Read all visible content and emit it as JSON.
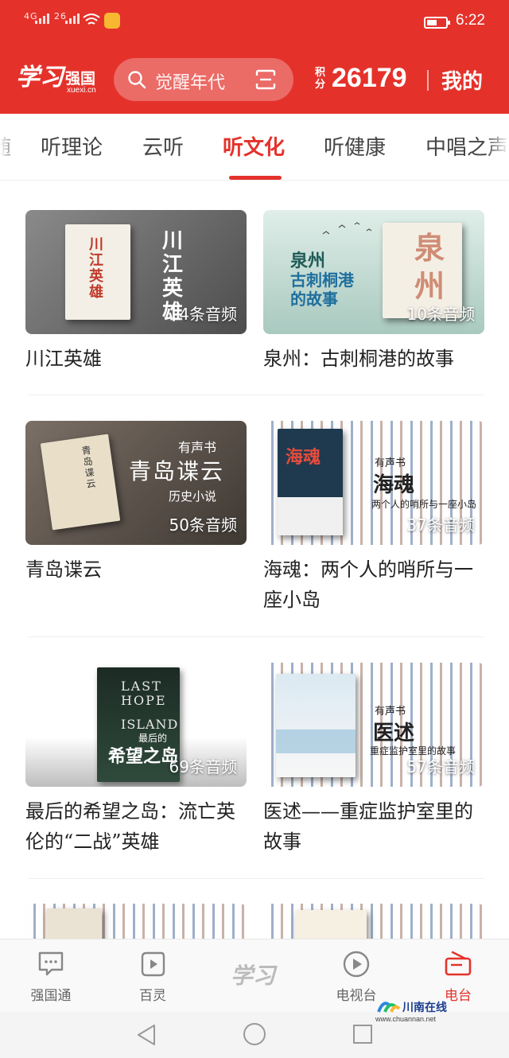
{
  "status_bar": {
    "network_1": "4G",
    "network_2": "26",
    "time": "6:22"
  },
  "header": {
    "logo_script": "学习",
    "logo_name": "强国",
    "logo_url": "xuexi.cn",
    "search_placeholder": "觉醒年代",
    "points_label": "积分",
    "points_value": "26179",
    "mine_label": "我的"
  },
  "tabs": [
    {
      "label": "随"
    },
    {
      "label": "听理论"
    },
    {
      "label": "云听"
    },
    {
      "label": "听文化",
      "active": true
    },
    {
      "label": "听健康"
    },
    {
      "label": "中唱之声"
    }
  ],
  "cards": [
    {
      "title": "川江英雄",
      "count": "4条音频",
      "cover_text": "川江英雄"
    },
    {
      "title": "泉州：古刺桐港的故事",
      "count": "10条音频",
      "cover_line1": "泉州",
      "cover_line2": "古刺桐港",
      "cover_line3": "的故事",
      "cover_big": "泉州"
    },
    {
      "title": "青岛谍云",
      "count": "50条音频",
      "cover_tag": "有声书",
      "cover_main": "青岛谍云",
      "cover_sub": "历史小说",
      "book_title": "青岛谍云"
    },
    {
      "title": "海魂：两个人的哨所与一座小岛",
      "count": "37条音频",
      "cover_tag": "有声书",
      "cover_main": "海魂",
      "cover_sub": "两个人的哨所与一座小岛",
      "book_title": "海魂"
    },
    {
      "title": "最后的希望之岛：流亡英伦的“二战”英雄",
      "count": "69条音频",
      "cover_en1": "LAST",
      "cover_en2": "HOPE",
      "cover_en3": "ISLAND",
      "cover_zh1": "最后的",
      "cover_zh2": "希望之岛"
    },
    {
      "title": "医述——重症监护室里的故事",
      "count": "57条音频",
      "cover_tag": "有声书",
      "cover_main": "医述",
      "cover_sub": "重症监护室里的故事"
    }
  ],
  "bottom_nav": [
    {
      "label": "强国通",
      "icon": "chat-icon"
    },
    {
      "label": "百灵",
      "icon": "play-square-icon"
    },
    {
      "label": "",
      "icon": "xuexi-logo"
    },
    {
      "label": "电视台",
      "icon": "play-circle-icon"
    },
    {
      "label": "电台",
      "icon": "radio-icon",
      "active": true
    }
  ],
  "center_logo": "学习",
  "watermark": {
    "name": "川南在线",
    "url": "www.chuannan.net"
  },
  "colors": {
    "brand_red": "#e4322b",
    "tab_active": "#e4322b"
  }
}
